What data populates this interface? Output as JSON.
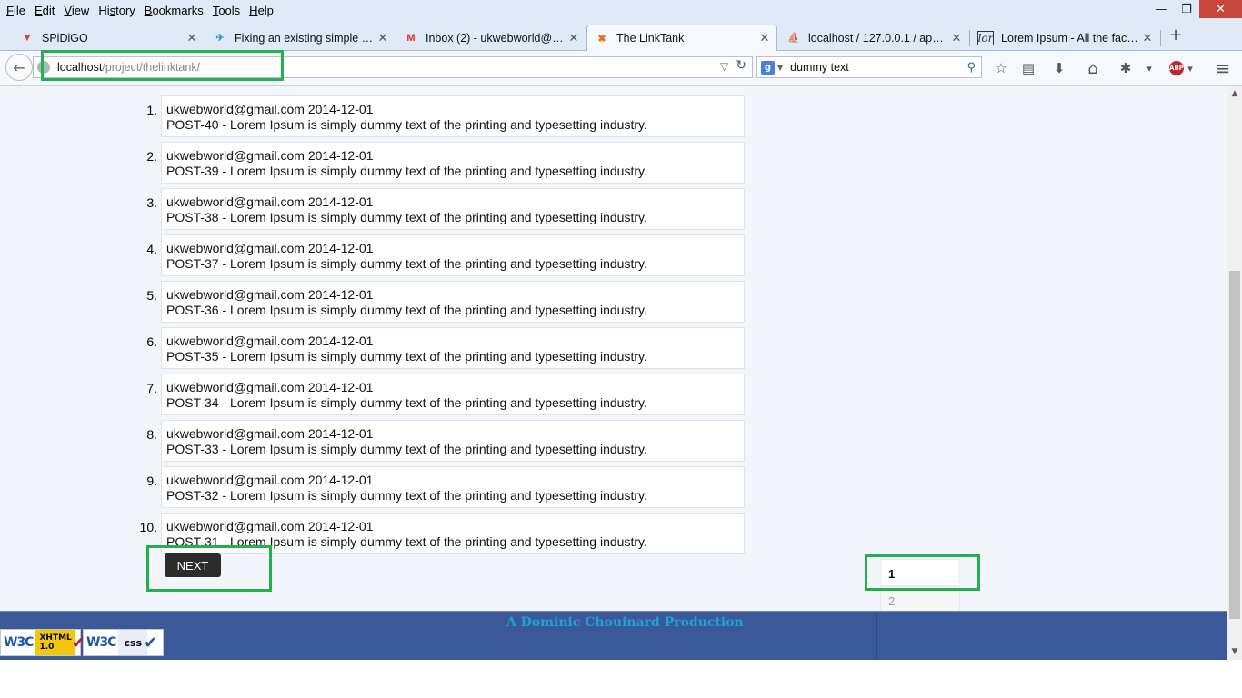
{
  "menu": {
    "items": [
      {
        "pre": "",
        "key": "F",
        "post": "ile"
      },
      {
        "pre": "",
        "key": "E",
        "post": "dit"
      },
      {
        "pre": "",
        "key": "V",
        "post": "iew"
      },
      {
        "pre": "Hi",
        "key": "s",
        "post": "tory"
      },
      {
        "pre": "",
        "key": "B",
        "post": "ookmarks"
      },
      {
        "pre": "",
        "key": "T",
        "post": "ools"
      },
      {
        "pre": "",
        "key": "H",
        "post": "elp"
      }
    ]
  },
  "window_controls": {
    "minimize": "—",
    "restore": "❐",
    "close": "✕"
  },
  "tabs": [
    {
      "title": "SPiDiGO",
      "icon": "spidigo-icon",
      "glyph": "▼",
      "color": "#d2452c",
      "active": false
    },
    {
      "title": "Fixing an existing simple p...",
      "icon": "twitter-bird-icon",
      "glyph": "✈",
      "color": "#1f9bd6",
      "active": false
    },
    {
      "title": "Inbox (2) - ukwebworld@g...",
      "icon": "gmail-icon",
      "glyph": "M",
      "color": "#d93025",
      "active": false
    },
    {
      "title": "The LinkTank",
      "icon": "xampp-icon",
      "glyph": "✖",
      "color": "#e8711c",
      "active": true
    },
    {
      "title": "localhost / 127.0.0.1 / apna...",
      "icon": "phpmyadmin-icon",
      "glyph": "⛵",
      "color": "#e8a317",
      "active": false
    },
    {
      "title": "Lorem Ipsum - All the facts...",
      "icon": "lorem-ipsum-icon",
      "glyph": "lor",
      "color": "#333333",
      "active": false
    }
  ],
  "tab_close_glyph": "✕",
  "new_tab_glyph": "+",
  "nav": {
    "back_glyph": "←",
    "url_host": "localhost",
    "url_path": "/project/thelinktank/",
    "url_dropdown_glyph": "▽",
    "reload_glyph": "↻",
    "search_engine_glyph": "g",
    "search_dropdown_glyph": "▼",
    "search_value": "dummy text",
    "search_go_glyph": "⚲"
  },
  "toolbar": {
    "bookmark_glyph": "☆",
    "bookmarks_menu_glyph": "▤",
    "download_glyph": "⬇",
    "home_glyph": "⌂",
    "extension_glyph": "✱",
    "extension_dropdown_glyph": "▾",
    "abp_label": "ABP",
    "abp_dropdown_glyph": "▾",
    "menu_glyph": "≡"
  },
  "posts": [
    {
      "n": "1.",
      "author": "ukwebworld@gmail.com",
      "date": "2014-12-01",
      "title": "POST-40 - Lorem Ipsum is simply dummy text of the printing and typesetting industry."
    },
    {
      "n": "2.",
      "author": "ukwebworld@gmail.com",
      "date": "2014-12-01",
      "title": "POST-39 - Lorem Ipsum is simply dummy text of the printing and typesetting industry."
    },
    {
      "n": "3.",
      "author": "ukwebworld@gmail.com",
      "date": "2014-12-01",
      "title": "POST-38 - Lorem Ipsum is simply dummy text of the printing and typesetting industry."
    },
    {
      "n": "4.",
      "author": "ukwebworld@gmail.com",
      "date": "2014-12-01",
      "title": "POST-37 - Lorem Ipsum is simply dummy text of the printing and typesetting industry."
    },
    {
      "n": "5.",
      "author": "ukwebworld@gmail.com",
      "date": "2014-12-01",
      "title": "POST-36 - Lorem Ipsum is simply dummy text of the printing and typesetting industry."
    },
    {
      "n": "6.",
      "author": "ukwebworld@gmail.com",
      "date": "2014-12-01",
      "title": "POST-35 - Lorem Ipsum is simply dummy text of the printing and typesetting industry."
    },
    {
      "n": "7.",
      "author": "ukwebworld@gmail.com",
      "date": "2014-12-01",
      "title": "POST-34 - Lorem Ipsum is simply dummy text of the printing and typesetting industry."
    },
    {
      "n": "8.",
      "author": "ukwebworld@gmail.com",
      "date": "2014-12-01",
      "title": "POST-33 - Lorem Ipsum is simply dummy text of the printing and typesetting industry."
    },
    {
      "n": "9.",
      "author": "ukwebworld@gmail.com",
      "date": "2014-12-01",
      "title": "POST-32 - Lorem Ipsum is simply dummy text of the printing and typesetting industry."
    },
    {
      "n": "10.",
      "author": "ukwebworld@gmail.com",
      "date": "2014-12-01",
      "title": "POST-31 - Lorem Ipsum is simply dummy text of the printing and typesetting industry."
    }
  ],
  "next_label": "NEXT",
  "pagination": [
    {
      "label": "1",
      "current": true
    },
    {
      "label": "2",
      "current": false
    }
  ],
  "footer": {
    "credit": "A Dominic Chouinard Production",
    "badges": [
      {
        "w3": "W3C",
        "label_line1": "XHTML",
        "label_line2": "1.0",
        "check": "✔"
      },
      {
        "w3": "W3C",
        "label_line1": "css",
        "label_line2": "",
        "check": "✔"
      }
    ]
  },
  "scrollbar": {
    "up_glyph": "▲",
    "down_glyph": "▼"
  },
  "colors": {
    "highlight": "#22b14c",
    "footer_bg": "#3b5998",
    "footer_text": "#1fa2d6",
    "next_button_bg": "#2c2c2c",
    "page_bg": "#f2f5f9"
  }
}
